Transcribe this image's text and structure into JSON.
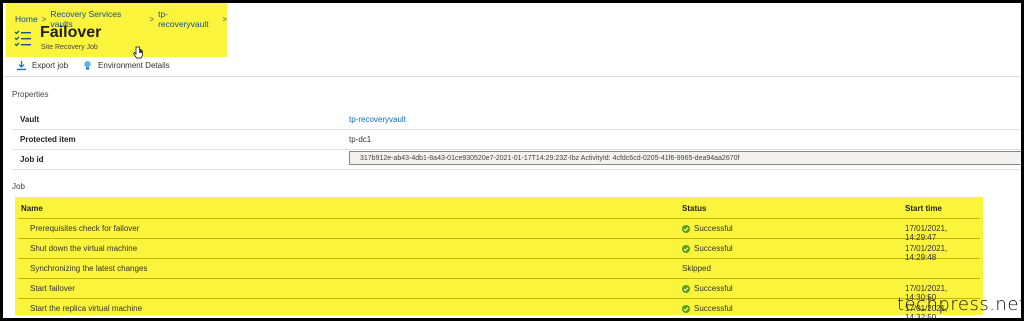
{
  "breadcrumb": [
    "Home",
    "Recovery Services vaults",
    "tp-recoveryvault"
  ],
  "header": {
    "title": "Failover",
    "subtitle": "Site Recovery Job",
    "icon": "checklist-icon"
  },
  "toolbar": {
    "export_label": "Export job",
    "environment_label": "Environment Details"
  },
  "properties": {
    "section_label": "Properties",
    "vault_key": "Vault",
    "vault_value": "tp-recoveryvault",
    "protected_key": "Protected item",
    "protected_value": "tp-dc1",
    "jobid_key": "Job id",
    "jobid_value": "317b912e-ab43-4db1-8a43-01ce930520e7-2021-01-17T14:29:23Z-Ibz ActivityId: 4cfdc6cd-0205-41f6-9965-dea94aa2670f"
  },
  "job": {
    "section_label": "Job",
    "columns": {
      "name": "Name",
      "status": "Status",
      "start": "Start time"
    },
    "rows": [
      {
        "name": "Prerequisites check for failover",
        "status": "Successful",
        "start": "17/01/2021, 14:29:47",
        "ok": true
      },
      {
        "name": "Shut down the virtual machine",
        "status": "Successful",
        "start": "17/01/2021, 14:29:48",
        "ok": true
      },
      {
        "name": "Synchronizing the latest changes",
        "status": "Skipped",
        "start": "",
        "ok": false
      },
      {
        "name": "Start failover",
        "status": "Successful",
        "start": "17/01/2021, 14:30:50",
        "ok": true
      },
      {
        "name": "Start the replica virtual machine",
        "status": "Successful",
        "start": "17/01/2021, 14:32:50",
        "ok": true
      }
    ]
  },
  "watermark": "techpress.net",
  "colors": {
    "highlight": "#fbf43c",
    "success": "#57a300",
    "link": "#0f6cbd"
  }
}
